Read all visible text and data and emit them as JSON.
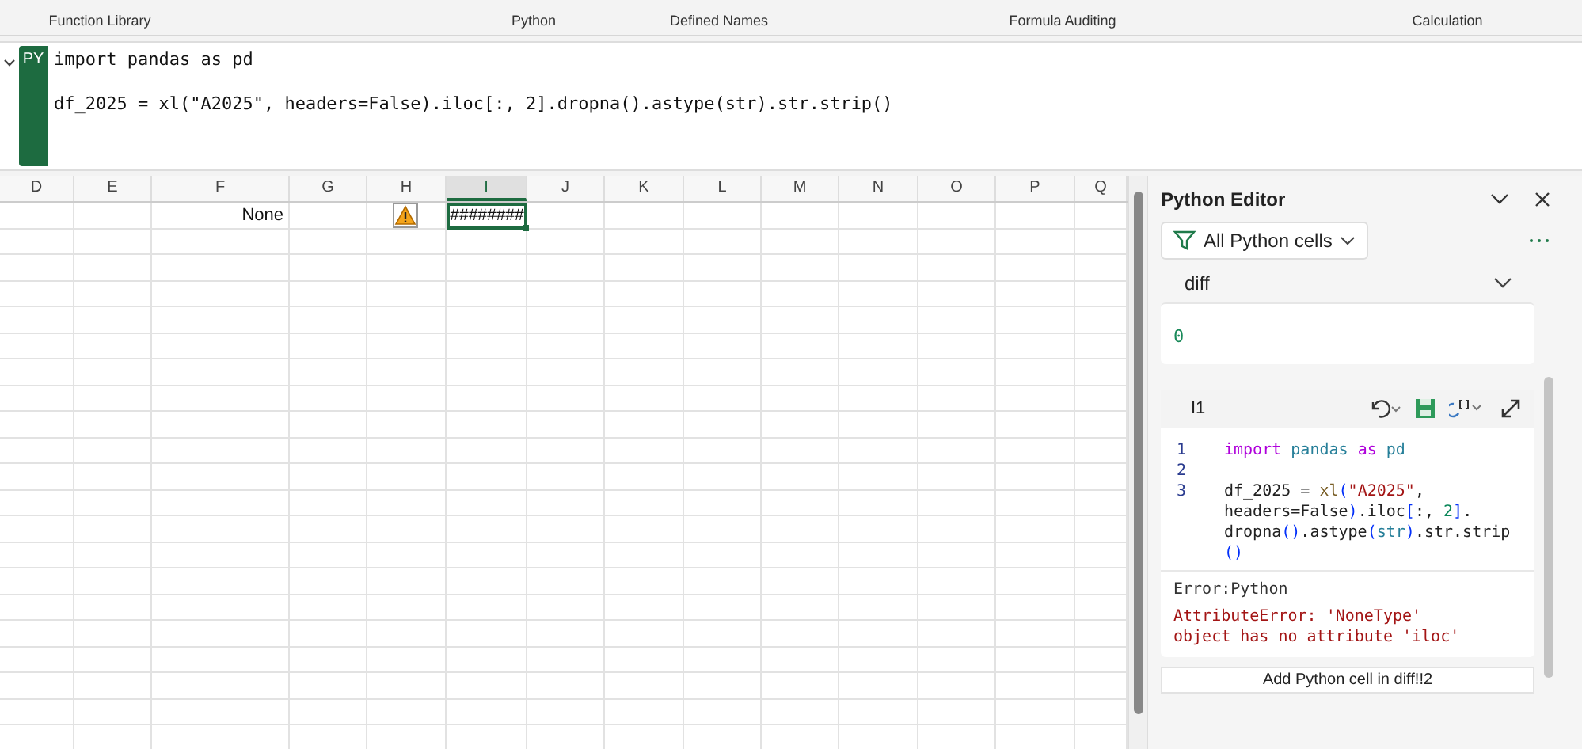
{
  "ribbon": {
    "groups": [
      "Function Library",
      "Python",
      "Defined Names",
      "Formula Auditing",
      "Calculation"
    ]
  },
  "formula_bar": {
    "badge": "PY",
    "expanded": true,
    "code": "import pandas as pd\n\ndf_2025 = xl(\"A2025\", headers=False).iloc[:, 2].dropna().astype(str).str.strip()"
  },
  "sheet": {
    "columns": [
      {
        "label": "D",
        "selected": false
      },
      {
        "label": "E",
        "selected": false
      },
      {
        "label": "F",
        "selected": false
      },
      {
        "label": "G",
        "selected": false
      },
      {
        "label": "H",
        "selected": false
      },
      {
        "label": "I",
        "selected": true
      },
      {
        "label": "J",
        "selected": false
      },
      {
        "label": "K",
        "selected": false
      },
      {
        "label": "L",
        "selected": false
      },
      {
        "label": "M",
        "selected": false
      },
      {
        "label": "N",
        "selected": false
      },
      {
        "label": "O",
        "selected": false
      },
      {
        "label": "P",
        "selected": false
      },
      {
        "label": "Q",
        "selected": false
      }
    ],
    "first_row": [
      {
        "kind": "empty"
      },
      {
        "kind": "empty"
      },
      {
        "kind": "text",
        "text": "None"
      },
      {
        "kind": "empty"
      },
      {
        "kind": "warning"
      },
      {
        "kind": "text",
        "text": "########"
      },
      {
        "kind": "empty"
      },
      {
        "kind": "empty"
      },
      {
        "kind": "empty"
      },
      {
        "kind": "empty"
      },
      {
        "kind": "empty"
      },
      {
        "kind": "empty"
      },
      {
        "kind": "empty"
      },
      {
        "kind": "empty"
      }
    ]
  },
  "editor": {
    "title": "Python Editor",
    "filter": "All Python cells",
    "section": "diff",
    "previous_output": "0",
    "cell": {
      "ref": "I1",
      "lines": [
        {
          "number": "1",
          "tokens": [
            {
              "kind": "keyword",
              "text": "import "
            },
            {
              "kind": "module",
              "text": "pandas "
            },
            {
              "kind": "keyword",
              "text": "as "
            },
            {
              "kind": "module",
              "text": "pd"
            }
          ]
        },
        {
          "number": "2"
        },
        {
          "number": "3",
          "tokens": [
            {
              "kind": "plain",
              "text": "df_2025 = "
            },
            {
              "kind": "func",
              "text": "xl"
            },
            {
              "kind": "paren",
              "text": "("
            },
            {
              "kind": "string",
              "text": "\"A2025\""
            },
            {
              "kind": "plain",
              "text": ","
            }
          ]
        },
        {
          "tokens": [
            {
              "kind": "plain",
              "text": "headers=False"
            },
            {
              "kind": "paren",
              "text": ")"
            },
            {
              "kind": "plain",
              "text": ".iloc"
            },
            {
              "kind": "paren",
              "text": "["
            },
            {
              "kind": "plain",
              "text": ":, "
            },
            {
              "kind": "number",
              "text": "2"
            },
            {
              "kind": "paren",
              "text": "]"
            },
            {
              "kind": "plain",
              "text": "."
            }
          ]
        },
        {
          "tokens": [
            {
              "kind": "plain",
              "text": "dropna"
            },
            {
              "kind": "paren",
              "text": "()"
            },
            {
              "kind": "plain",
              "text": ".astype"
            },
            {
              "kind": "paren",
              "text": "("
            },
            {
              "kind": "module",
              "text": "str"
            },
            {
              "kind": "paren",
              "text": ")"
            },
            {
              "kind": "plain",
              "text": ".str.strip"
            }
          ]
        },
        {
          "tokens": [
            {
              "kind": "paren",
              "text": "()"
            }
          ]
        }
      ],
      "error_label": "Error:Python",
      "error_message": "AttributeError: 'NoneType' object has no attribute 'iloc'"
    },
    "add_cell": "Add Python cell in diff!!2"
  }
}
